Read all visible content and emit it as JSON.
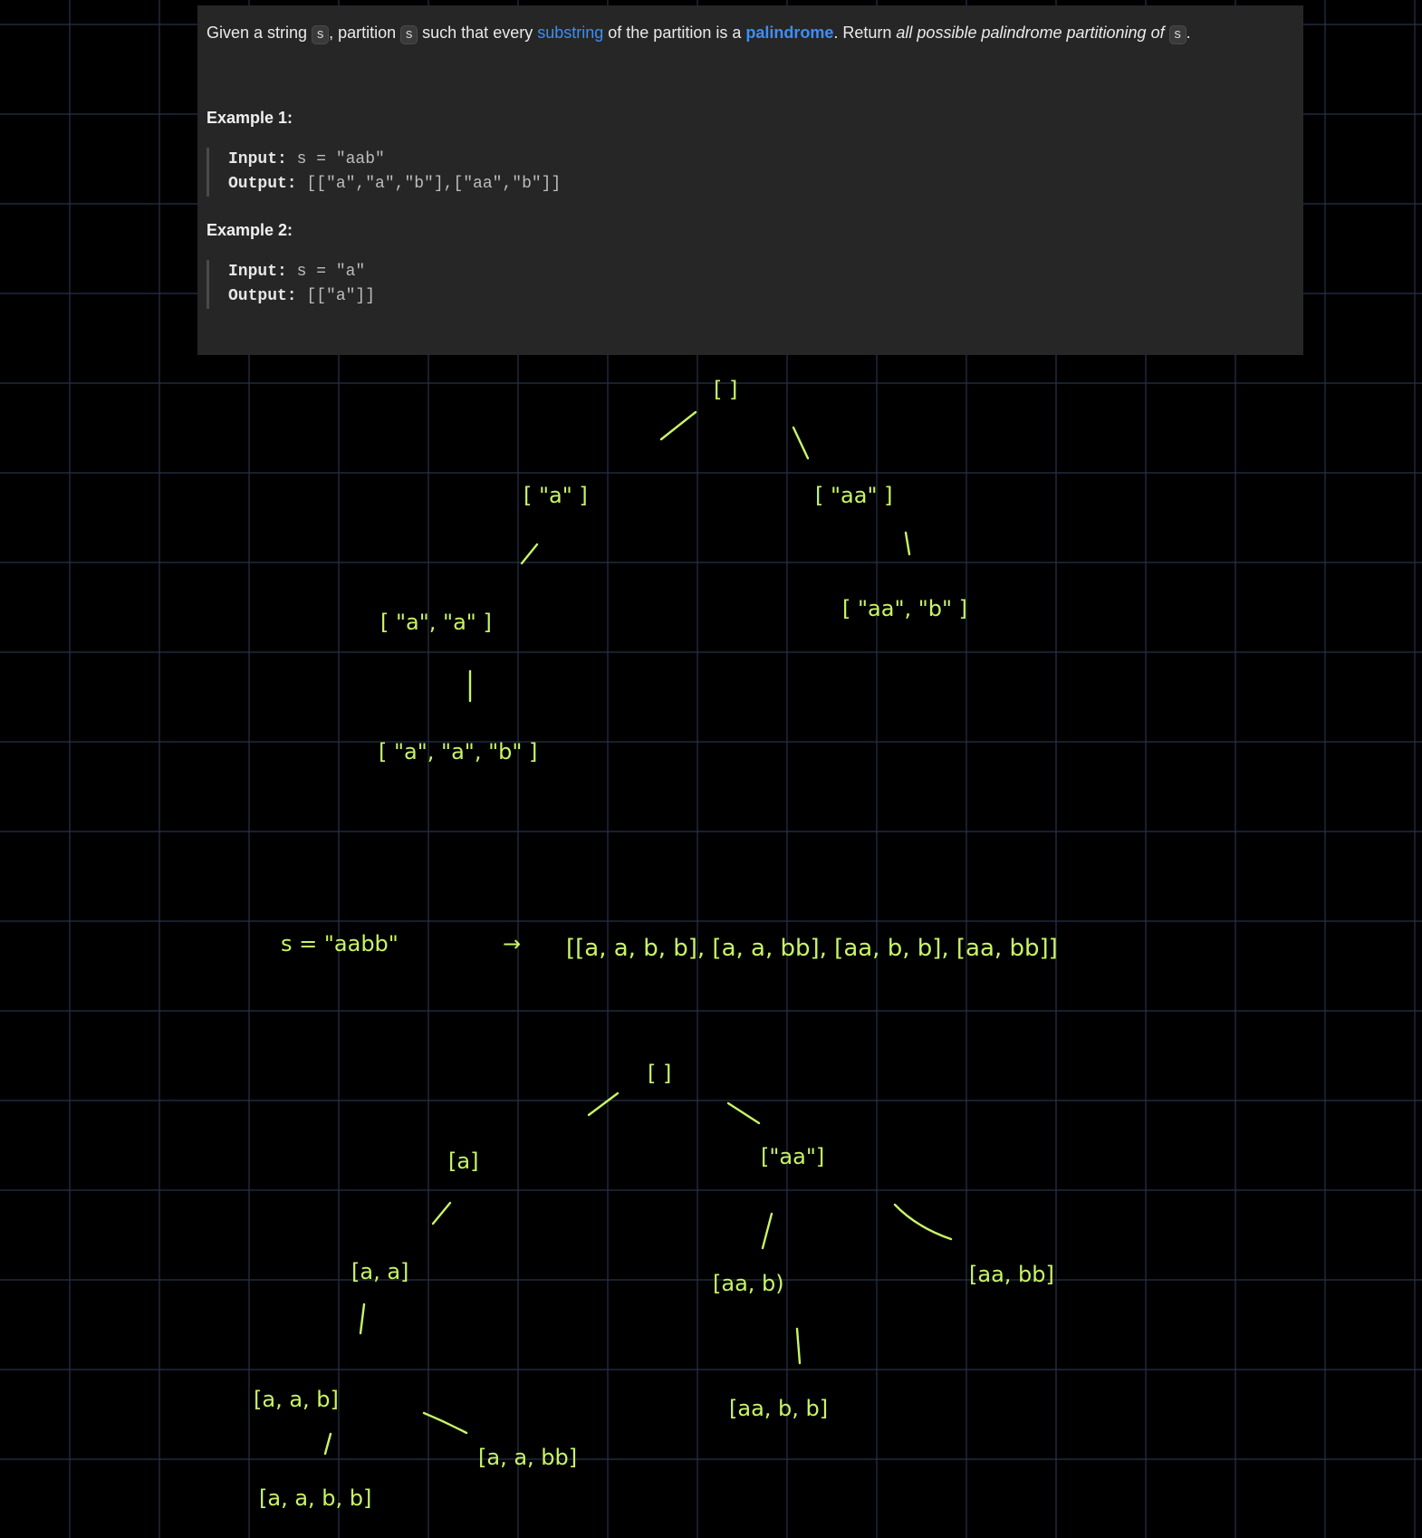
{
  "problem": {
    "stmt_given": "Given a string ",
    "stmt_s1": "s",
    "stmt_partition": ", partition ",
    "stmt_s2": "s",
    "stmt_such": " such that every ",
    "stmt_substring": "substring",
    "stmt_of_the": " of the partition is a ",
    "stmt_palindrome": "palindrome",
    "stmt_return": ". Return ",
    "stmt_all": "all possible palindrome partitioning of ",
    "stmt_s3": "s",
    "stmt_end": ".",
    "example1": {
      "title": "Example 1:",
      "input_label": "Input:",
      "input_value": " s = \"aab\"",
      "output_label": "Output:",
      "output_value": " [[\"a\",\"a\",\"b\"],[\"aa\",\"b\"]]"
    },
    "example2": {
      "title": "Example 2:",
      "input_label": "Input:",
      "input_value": " s = \"a\"",
      "output_label": "Output:",
      "output_value": " [[\"a\"]]"
    }
  },
  "sketch": {
    "tree1": {
      "root": "[ ]",
      "n_a": "[ \"a\" ]",
      "n_aa": "[ \"aa\" ]",
      "n_a_a": "[ \"a\", \"a\" ]",
      "n_aa_b": "[ \"aa\", \"b\" ]",
      "n_a_a_b": "[ \"a\", \"a\", \"b\" ]"
    },
    "equation": {
      "lhs": "s = \"aabb\"",
      "arrow": "→",
      "rhs": "[[a, a, b, b], [a, a, bb], [aa, b, b], [aa, bb]]"
    },
    "tree2": {
      "root": "[ ]",
      "n_a": "[a]",
      "n_aa": "[\"aa\"]",
      "n_a_a": "[a, a]",
      "n_aa_b": "[aa, b)",
      "n_aa_bb": "[aa, bb]",
      "n_a_a_b": "[a, a, b]",
      "n_a_a_bb": "[a, a, bb]",
      "n_a_a_b_b": "[a, a, b, b]",
      "n_aa_b_b": "[aa, b, b]"
    }
  },
  "colors": {
    "background": "#000000",
    "grid": "#27324a",
    "panel": "#262626",
    "ink": "#c8f566",
    "link": "#3d8ef7"
  }
}
